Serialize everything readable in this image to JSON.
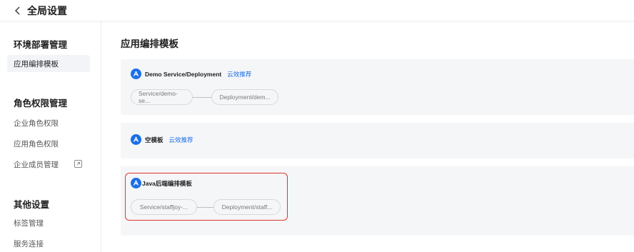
{
  "header": {
    "back_icon": "chevron-left-icon",
    "title": "全局设置"
  },
  "sidebar": {
    "groups": [
      {
        "title": "环境部署管理",
        "items": [
          {
            "label": "应用编排模板",
            "active": true
          }
        ]
      },
      {
        "title": "角色权限管理",
        "items": [
          {
            "label": "企业角色权限"
          },
          {
            "label": "应用角色权限"
          },
          {
            "label": "企业成员管理",
            "icon": "external-link-icon"
          }
        ]
      },
      {
        "title": "其他设置",
        "items": [
          {
            "label": "标签管理"
          },
          {
            "label": "服务连接"
          }
        ]
      }
    ]
  },
  "main": {
    "title": "应用编排模板",
    "templates": [
      {
        "name": "Demo Service/Deployment",
        "tag": "云效推荐",
        "nodes": [
          "Service/demo-se...",
          "Deployment/dem..."
        ]
      },
      {
        "name": "空模板",
        "tag": "云效推荐",
        "nodes": []
      },
      {
        "name": "Java后端编排模板",
        "tag": "",
        "nodes": [
          "Service/staffjoy-...",
          "Deployment/staff..."
        ],
        "highlighted": true
      }
    ]
  },
  "colors": {
    "accent": "#1b6fe8",
    "highlight_border": "#e0362c",
    "card_bg": "#f5f6f8"
  }
}
